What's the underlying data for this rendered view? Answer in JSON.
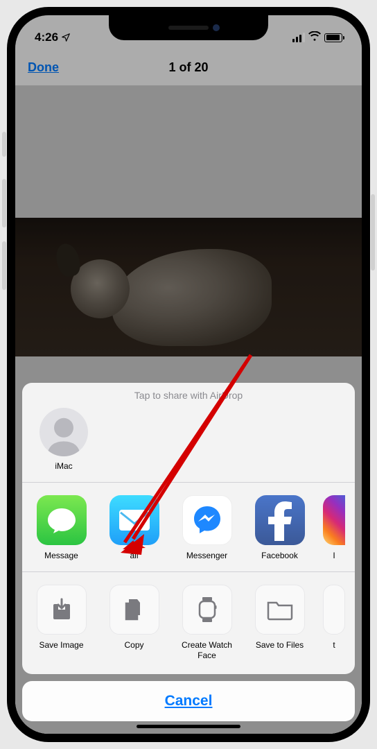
{
  "status": {
    "time": "4:26"
  },
  "nav": {
    "done": "Done",
    "title": "1 of 20"
  },
  "sheet": {
    "airdrop_header": "Tap to share with AirDrop",
    "airdrop": [
      {
        "label": "iMac"
      }
    ],
    "apps": [
      {
        "id": "message",
        "label": "Message"
      },
      {
        "id": "mail",
        "label": "ail"
      },
      {
        "id": "messenger",
        "label": "Messenger"
      },
      {
        "id": "facebook",
        "label": "Facebook"
      },
      {
        "id": "instagram",
        "label": "I"
      }
    ],
    "actions": [
      {
        "id": "save-image",
        "label": "Save Image"
      },
      {
        "id": "copy",
        "label": "Copy"
      },
      {
        "id": "watchface",
        "label": "Create Watch Face"
      },
      {
        "id": "files",
        "label": "Save to Files"
      },
      {
        "id": "more",
        "label": "t"
      }
    ],
    "cancel": "Cancel"
  }
}
